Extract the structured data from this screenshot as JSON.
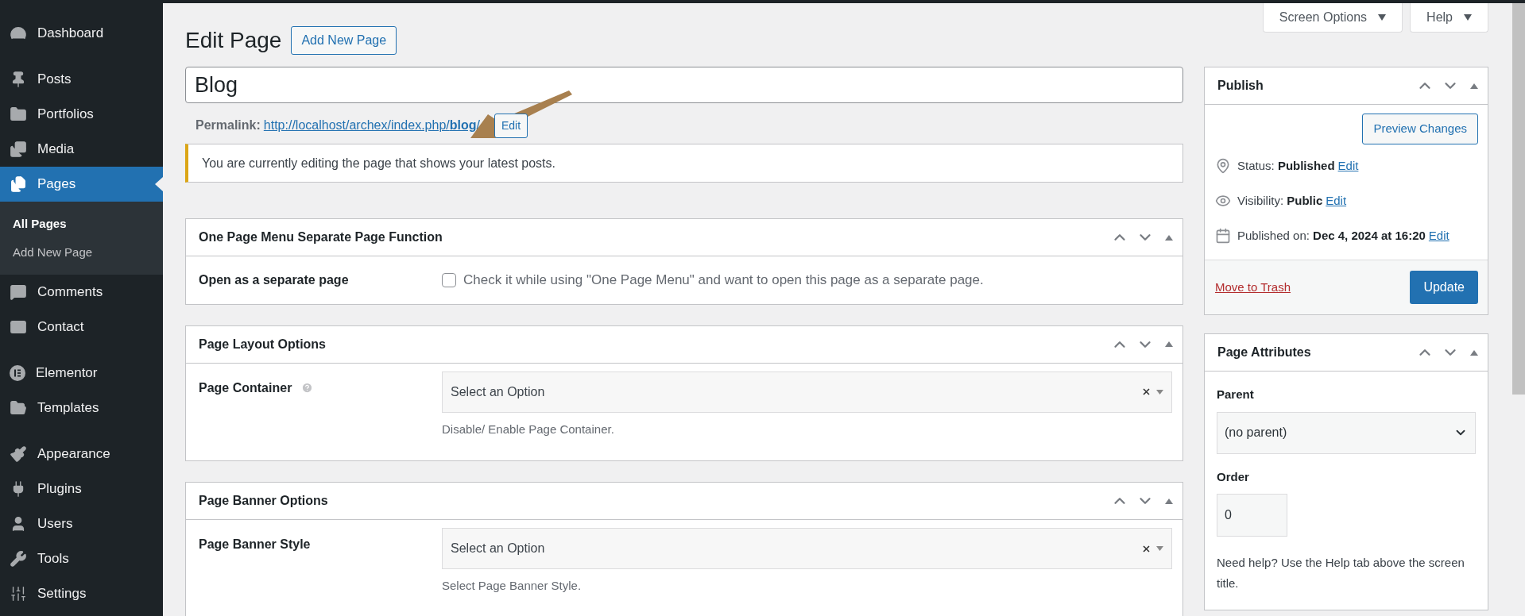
{
  "sidebar": {
    "items": [
      {
        "label": "Dashboard",
        "selected": false
      },
      {
        "label": "Posts",
        "selected": false
      },
      {
        "label": "Portfolios",
        "selected": false
      },
      {
        "label": "Media",
        "selected": false
      },
      {
        "label": "Pages",
        "selected": true,
        "children": [
          {
            "label": "All Pages",
            "selected": true
          },
          {
            "label": "Add New Page",
            "selected": false
          }
        ]
      },
      {
        "label": "Comments",
        "selected": false
      },
      {
        "label": "Contact",
        "selected": false
      },
      {
        "label": "Elementor",
        "selected": false
      },
      {
        "label": "Templates",
        "selected": false
      },
      {
        "label": "Appearance",
        "selected": false
      },
      {
        "label": "Plugins",
        "selected": false
      },
      {
        "label": "Users",
        "selected": false
      },
      {
        "label": "Tools",
        "selected": false
      },
      {
        "label": "Settings",
        "selected": false
      }
    ]
  },
  "header": {
    "title": "Edit Page",
    "add_button": "Add New Page",
    "screen_options": "Screen Options",
    "help": "Help"
  },
  "title_field": {
    "value": "Blog"
  },
  "permalink": {
    "label": "Permalink:",
    "url": "http://localhost/archex/index.php/**blog**/",
    "edit_button": "Edit"
  },
  "notice": {
    "text": "You are currently editing the page that shows your latest posts."
  },
  "metaboxes": [
    {
      "title": "One Page Menu Separate Page Function",
      "fields": [
        {
          "kind": "checkbox",
          "label": "Open as a separate page",
          "checked": false,
          "text": "Check it while using \"One Page Menu\" and want to open this page as a separate page."
        }
      ]
    },
    {
      "title": "Page Layout Options",
      "fields": [
        {
          "kind": "select",
          "label": "Page Container",
          "help_icon": true,
          "placeholder": "Select an Option",
          "description": "Disable/ Enable Page Container."
        }
      ]
    },
    {
      "title": "Page Banner Options",
      "fields": [
        {
          "kind": "select",
          "label": "Page Banner Style",
          "help_icon": false,
          "placeholder": "Select an Option",
          "description": "Select Page Banner Style."
        }
      ]
    }
  ],
  "publish": {
    "title": "Publish",
    "preview_button": "Preview Changes",
    "rows": [
      {
        "label": "Status:",
        "value": "Published",
        "edit": "Edit"
      },
      {
        "label": "Visibility:",
        "value": "Public",
        "edit": "Edit"
      },
      {
        "label": "Published on:",
        "value": "Dec 4, 2024 at 16:20",
        "edit": "Edit"
      }
    ],
    "trash_link": "Move to Trash",
    "update_button": "Update"
  },
  "page_attributes": {
    "title": "Page Attributes",
    "parent_label": "Parent",
    "parent_value": "(no parent)",
    "order_label": "Order",
    "order_value": "0",
    "help_text": "Need help? Use the Help tab above the screen title."
  }
}
